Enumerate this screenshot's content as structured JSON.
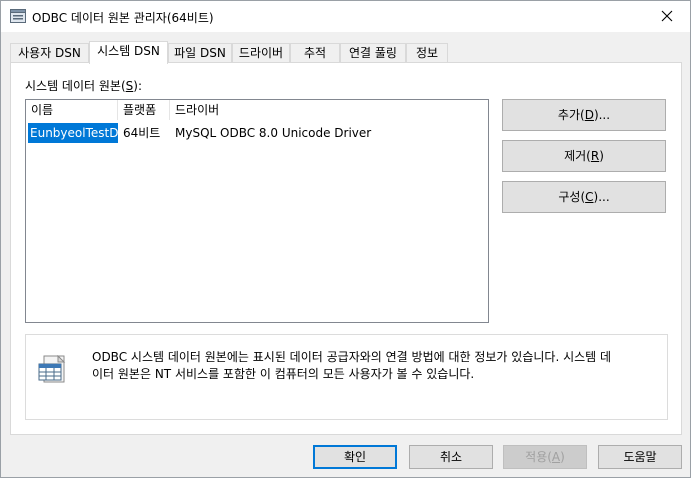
{
  "window": {
    "title": "ODBC 데이터 원본 관리자(64비트)",
    "icon": "odbc-app-icon",
    "close_icon": "close-icon"
  },
  "tabs": [
    {
      "label": "사용자 DSN",
      "active": false
    },
    {
      "label": "시스템 DSN",
      "active": true
    },
    {
      "label": "파일 DSN",
      "active": false
    },
    {
      "label": "드라이버",
      "active": false
    },
    {
      "label": "추적",
      "active": false
    },
    {
      "label": "연결 풀링",
      "active": false
    },
    {
      "label": "정보",
      "active": false
    }
  ],
  "panel": {
    "section_label_prefix": "시스템 데이터 원본(",
    "section_label_key": "S",
    "section_label_suffix": "):",
    "columns": [
      "이름",
      "플랫폼",
      "드라이버"
    ],
    "rows": [
      {
        "name": "EunbyeolTestDB",
        "platform": "64비트",
        "driver": "MySQL ODBC 8.0 Unicode Driver",
        "selected": true
      }
    ],
    "side_buttons": {
      "add": {
        "pre": "추가(",
        "key": "D",
        "post": ")..."
      },
      "remove": {
        "pre": "제거(",
        "key": "R",
        "post": ")"
      },
      "configure": {
        "pre": "구성(",
        "key": "C",
        "post": ")..."
      }
    },
    "info": {
      "icon": "datasource-info-icon",
      "line1": "ODBC 시스템 데이터 원본에는 표시된 데이터 공급자와의 연결 방법에 대한 정보가 있습니다. 시스템 데",
      "line2": "이터 원본은 NT 서비스를 포함한 이 컴퓨터의 모든 사용자가 볼 수 있습니다."
    }
  },
  "footer_buttons": {
    "ok": "확인",
    "cancel": "취소",
    "apply": {
      "pre": "적용(",
      "key": "A",
      "post": ")",
      "disabled": true
    },
    "help": "도움말"
  },
  "colors": {
    "selection": "#0078d7",
    "default_button_border": "#0078d7",
    "background": "#f0f0f0"
  }
}
